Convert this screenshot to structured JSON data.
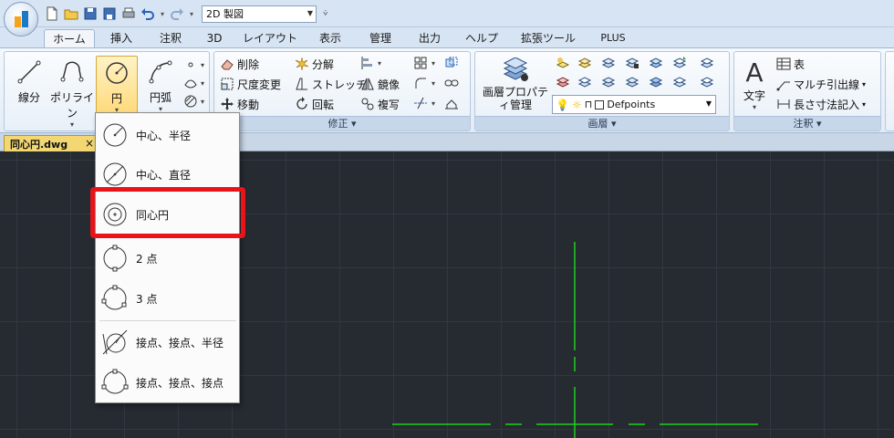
{
  "quick_access": {
    "workspace": "2D 製図"
  },
  "tabs": [
    {
      "label": "ホーム",
      "active": true
    },
    {
      "label": "挿入"
    },
    {
      "label": "注釈"
    },
    {
      "label": "3D"
    },
    {
      "label": "レイアウト"
    },
    {
      "label": "表示"
    },
    {
      "label": "管理"
    },
    {
      "label": "出力"
    },
    {
      "label": "ヘルプ"
    },
    {
      "label": "拡張ツール"
    },
    {
      "label": "PLUS"
    }
  ],
  "ribbon": {
    "draw": {
      "line": "線分",
      "polyline": "ポリライン",
      "circle": "円",
      "arc": "円弧"
    },
    "modify": {
      "title": "修正",
      "erase": "削除",
      "explode": "分解",
      "scale": "尺度変更",
      "stretch": "ストレッチ",
      "move": "移動",
      "mirror": "鏡像",
      "rotate": "回転",
      "copy": "複写"
    },
    "layers": {
      "title": "画層",
      "layer_properties": "画層プロパティ管理",
      "current_layer": "Defpoints"
    },
    "annotation": {
      "title": "注釈",
      "text": "文字",
      "table": "表",
      "multileader": "マルチ引出線",
      "linear_dim": "長さ寸法記入"
    }
  },
  "document": {
    "tab": "同心円.dwg",
    "close": "×"
  },
  "circle_menu": {
    "items": [
      {
        "label": "中心、半径",
        "icon": "circle-center-radius-icon"
      },
      {
        "label": "中心、直径",
        "icon": "circle-center-diameter-icon"
      },
      {
        "label": "同心円",
        "icon": "concentric-circle-icon",
        "highlighted": true
      },
      {
        "label": "2 点",
        "icon": "circle-2point-icon"
      },
      {
        "label": "3 点",
        "icon": "circle-3point-icon"
      },
      {
        "label": "接点、接点、半径",
        "icon": "circle-ttr-icon"
      },
      {
        "label": "接点、接点、接点",
        "icon": "circle-ttt-icon"
      }
    ]
  },
  "colors": {
    "canvas": "#262a31",
    "crosshair": "#1fd01f",
    "highlight": "#e8141a",
    "ribbon_tab_bar": "#d7e4f3"
  }
}
